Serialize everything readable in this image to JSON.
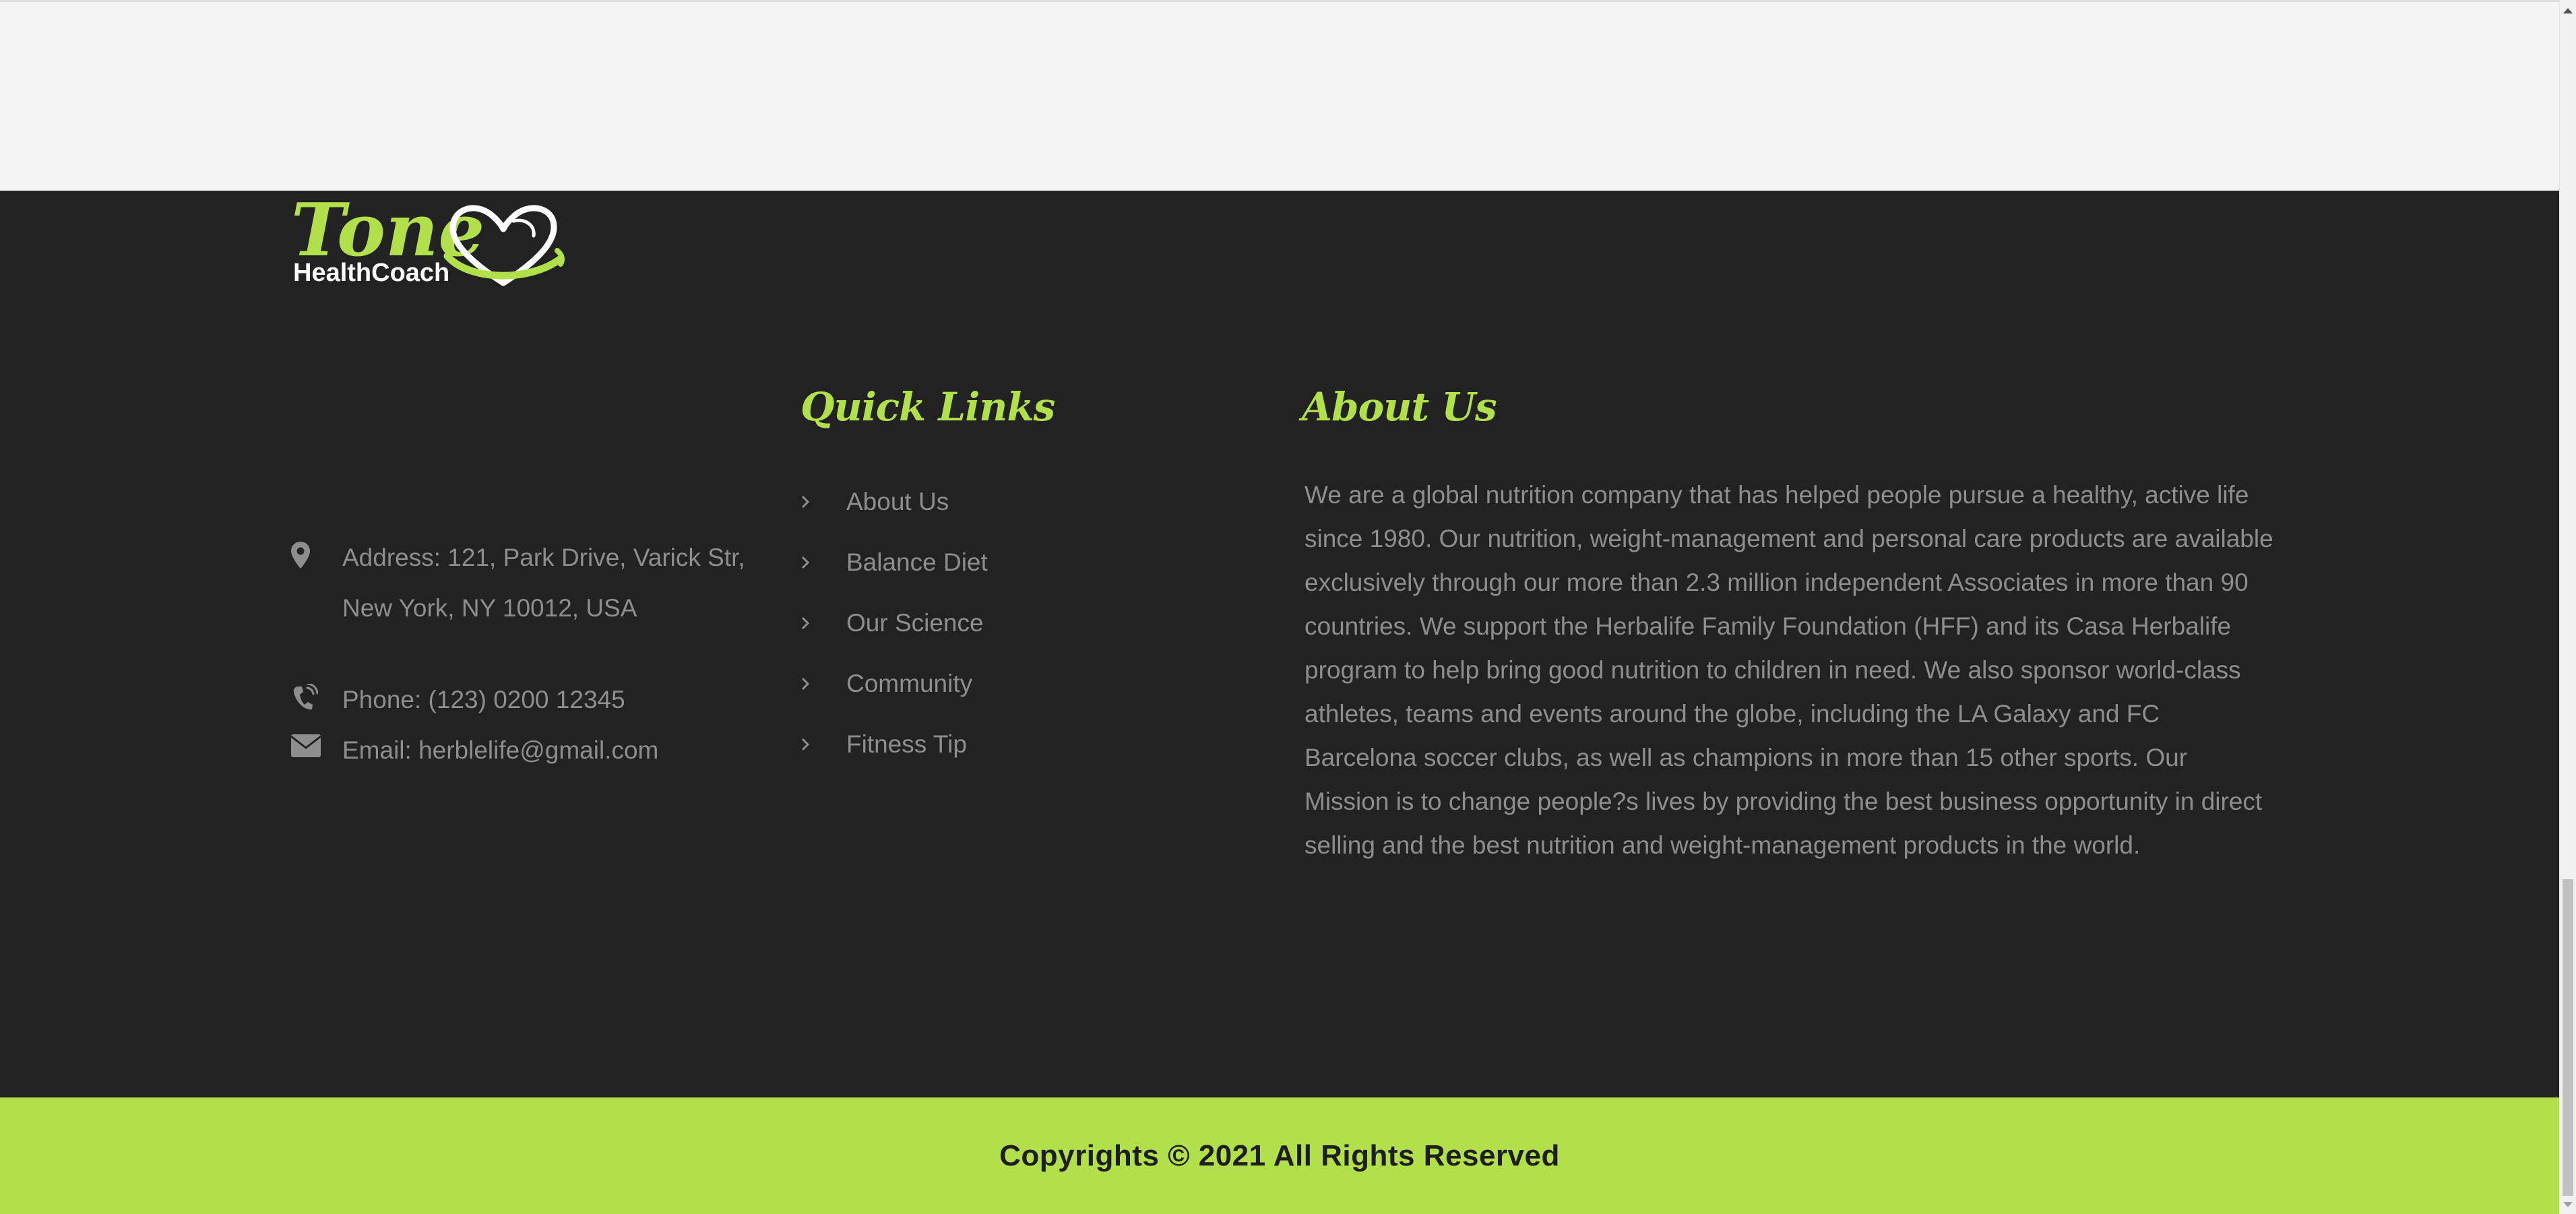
{
  "logo": {
    "word": "Tone",
    "subtitle": "HealthCoach",
    "icon": "heart-icon"
  },
  "contact": {
    "address": "Address: 121, Park Drive, Varick Str, New York, NY 10012, USA",
    "phone": "Phone: (123) 0200 12345",
    "email": "Email: herblelife@gmail.com",
    "icons": {
      "address": "map-marker-icon",
      "phone": "phone-icon",
      "email": "envelope-icon"
    }
  },
  "quick_links": {
    "heading": "Quick Links",
    "items": [
      {
        "label": "About Us",
        "icon": "chevron-right-icon"
      },
      {
        "label": "Balance Diet",
        "icon": "chevron-right-icon"
      },
      {
        "label": "Our Science",
        "icon": "chevron-right-icon"
      },
      {
        "label": "Community",
        "icon": "chevron-right-icon"
      },
      {
        "label": "Fitness Tip",
        "icon": "chevron-right-icon"
      }
    ]
  },
  "about": {
    "heading": "About Us",
    "text": "We are a global nutrition company that has helped people pursue a healthy, active life since 1980. Our nutrition, weight-management and personal care products are available exclusively through our more than 2.3 million independent Associates in more than 90 countries. We support the Herbalife Family Foundation (HFF) and its Casa Herbalife program to help bring good nutrition to children in need. We also sponsor world-class athletes, teams and events around the globe, including the LA Galaxy and FC Barcelona soccer clubs, as well as champions in more than 15 other sports. Our Mission is to change people?s lives by providing the best business opportunity in direct selling and the best nutrition and weight-management products in the world."
  },
  "footer": {
    "copyright": "Copyrights © 2021 All Rights Reserved"
  },
  "colors": {
    "accent": "#b2e04b",
    "footer_bg": "#222222",
    "text_muted": "#8e8e8e",
    "top_band": "#f4f4f4"
  }
}
